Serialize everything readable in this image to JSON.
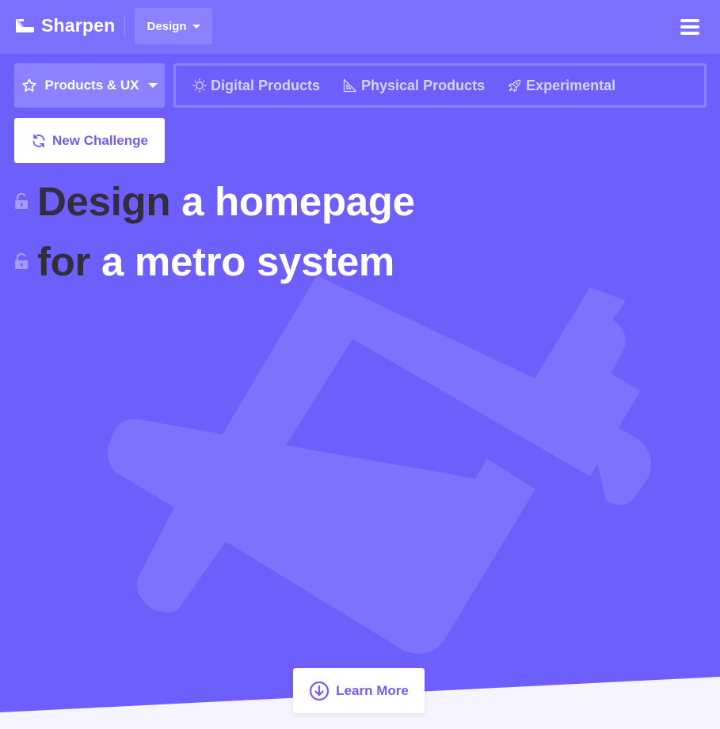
{
  "colors": {
    "accent": "#6c5ffc",
    "navbar": "#7b6ffd",
    "button_bg": "#8c81fe",
    "keyword": "#322e3f"
  },
  "navbar": {
    "brand": "Sharpen",
    "logo_icon": "sharpen-logo-icon",
    "category_label": "Design",
    "menu_icon": "hamburger-menu-icon"
  },
  "filters": {
    "product_dropdown": {
      "label": "Products & UX",
      "icon": "star-icon"
    },
    "subcategories": [
      {
        "label": "Digital Products",
        "icon": "lightbulb-icon"
      },
      {
        "label": "Physical Products",
        "icon": "set-square-icon"
      },
      {
        "label": "Experimental",
        "icon": "rocket-icon"
      }
    ]
  },
  "new_challenge": {
    "label": "New Challenge",
    "icon": "refresh-icon"
  },
  "challenge": {
    "line1": {
      "keyword": "Design",
      "rest": " a homepage"
    },
    "line2": {
      "keyword": "for",
      "rest": " a metro system"
    },
    "lock_icon": "unlock-icon"
  },
  "learn_more": {
    "label": "Learn More",
    "icon": "arrow-down-circle-icon"
  }
}
